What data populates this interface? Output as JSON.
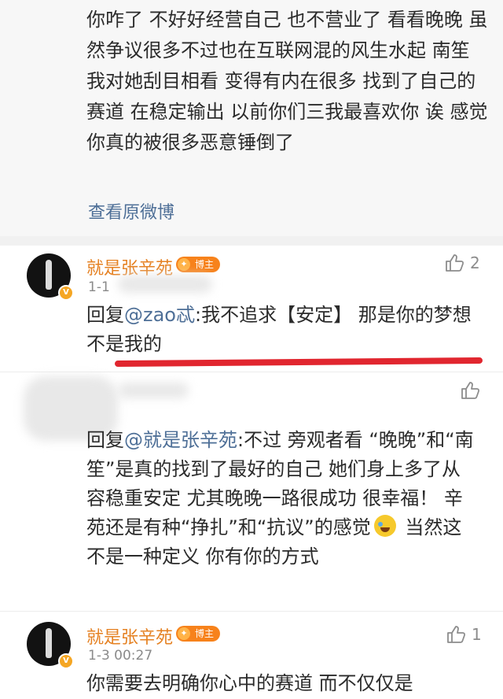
{
  "post": {
    "text": "你咋了 不好好经营自己 也不营业了 看看晚晚 虽然争议很多不过也在互联网混的风生水起 南笙 我对她刮目相看 变得有内在很多 找到了自己的赛道 在稳定输出 以前你们三我最喜欢你 诶 感觉你真的被很多恶意锤倒了",
    "view_original": "查看原微博"
  },
  "comments": [
    {
      "username": "就是张辛苑",
      "badge": "博主",
      "time": "1-1",
      "likes": "2",
      "reply_prefix": "回复",
      "mention": "@zao忒",
      "text": ":我不追求【安定】 那是你的梦想不是我的"
    },
    {
      "username": "",
      "time": "",
      "likes": "",
      "reply_prefix": "回复",
      "mention": "@就是张辛苑",
      "text_1": ":不过 旁观者看 “晚晚”和“南笙”是真的找到了最好的自己 她们身上多了从容稳重安定 尤其晚晚一路很成功 很幸福！ 辛苑还是有种“挣扎”和“抗议”的感觉",
      "text_2": " 当然这不是一种定义 你有你的方式"
    },
    {
      "username": "就是张辛苑",
      "badge": "博主",
      "time": "1-3 00:27",
      "likes": "1",
      "text": "你需要去明确你心中的赛道 而不仅仅是"
    }
  ],
  "colors": {
    "username": "#e58122",
    "mention": "#4e6f97",
    "underline": "#e1262f",
    "badge": "#f7821b"
  },
  "icons": [
    "thumb-up-icon",
    "verified-icon",
    "crying-laughing-emoji"
  ]
}
